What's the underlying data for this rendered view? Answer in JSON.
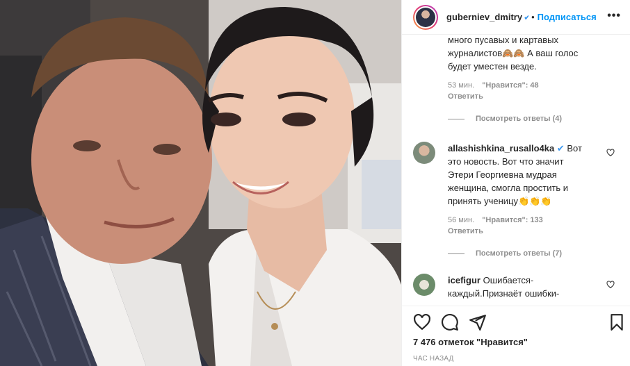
{
  "header": {
    "username": "guberniev_dmitry",
    "separator": "•",
    "follow_label": "Подписаться",
    "more_label": "•••"
  },
  "comments": [
    {
      "text_lines": [
        "много пусавых и картавых",
        "журналистов🙈🙈 А ваш голос",
        "будет уместен везде."
      ],
      "time": "53 мин.",
      "likes": "\"Нравится\": 48",
      "reply": "Ответить",
      "view_replies": "Посмотреть ответы (4)"
    },
    {
      "username": "allashishkina_rusallo4ka",
      "verified": true,
      "text_lines": [
        "Вот",
        "это новость. Вот что значит",
        "Этери Георгиевна мудрая",
        "женщина, смогла простить и",
        "принять ученицу👏👏👏"
      ],
      "time": "56 мин.",
      "likes": "\"Нравится\": 133",
      "reply": "Ответить",
      "view_replies": "Посмотреть ответы (7)"
    },
    {
      "username": "icefigur",
      "text_lines": [
        "Ошибается-",
        "каждый.Признаёт ошибки-"
      ]
    }
  ],
  "footer": {
    "likes": "7 476 отметок \"Нравится\"",
    "time": "час назад"
  },
  "colors": {
    "accent": "#0095f6",
    "verified": "#3897f0",
    "muted": "#8e8e8e"
  }
}
